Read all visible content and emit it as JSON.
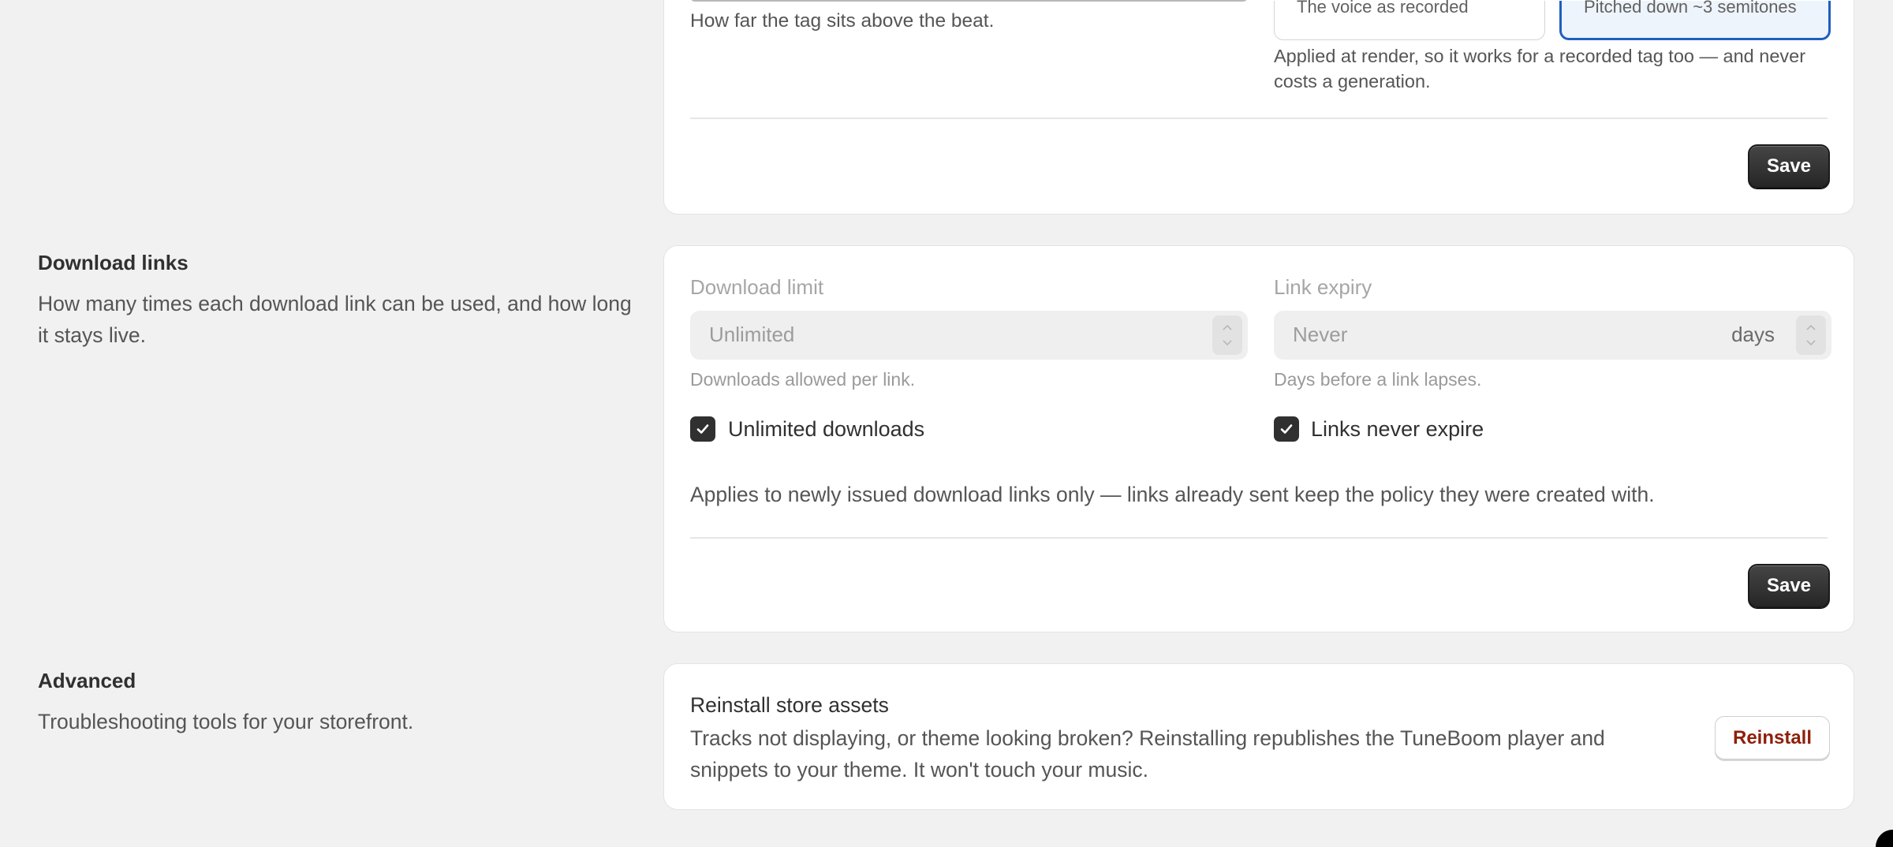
{
  "tag_section": {
    "position_help": "How far the tag sits above the beat.",
    "voice_options": [
      "The voice as recorded",
      "Pitched down ~3 semitones"
    ],
    "voice_help": "Applied at render, so it works for a recorded tag too — and never costs a generation.",
    "save_label": "Save"
  },
  "download_links": {
    "title": "Download links",
    "description": "How many times each download link can be used, and how long it stays live.",
    "limit_label": "Download limit",
    "limit_value": "Unlimited",
    "limit_help": "Downloads allowed per link.",
    "expiry_label": "Link expiry",
    "expiry_value": "Never",
    "expiry_suffix": "days",
    "expiry_help": "Days before a link lapses.",
    "unlimited_checkbox": "Unlimited downloads",
    "never_expire_checkbox": "Links never expire",
    "note": "Applies to newly issued download links only — links already sent keep the policy they were created with.",
    "save_label": "Save"
  },
  "advanced": {
    "title": "Advanced",
    "description": "Troubleshooting tools for your storefront.",
    "reinstall_title": "Reinstall store assets",
    "reinstall_desc": "Tracks not displaying, or theme looking broken? Reinstalling republishes the TuneBoom player and snippets to your theme. It won't touch your music.",
    "reinstall_button": "Reinstall"
  },
  "colors": {
    "background": "#f1f1f1",
    "card": "#ffffff",
    "primary_button": "#303030",
    "selected_outline": "#1f5fbf",
    "critical_text": "#8e1f0b"
  }
}
